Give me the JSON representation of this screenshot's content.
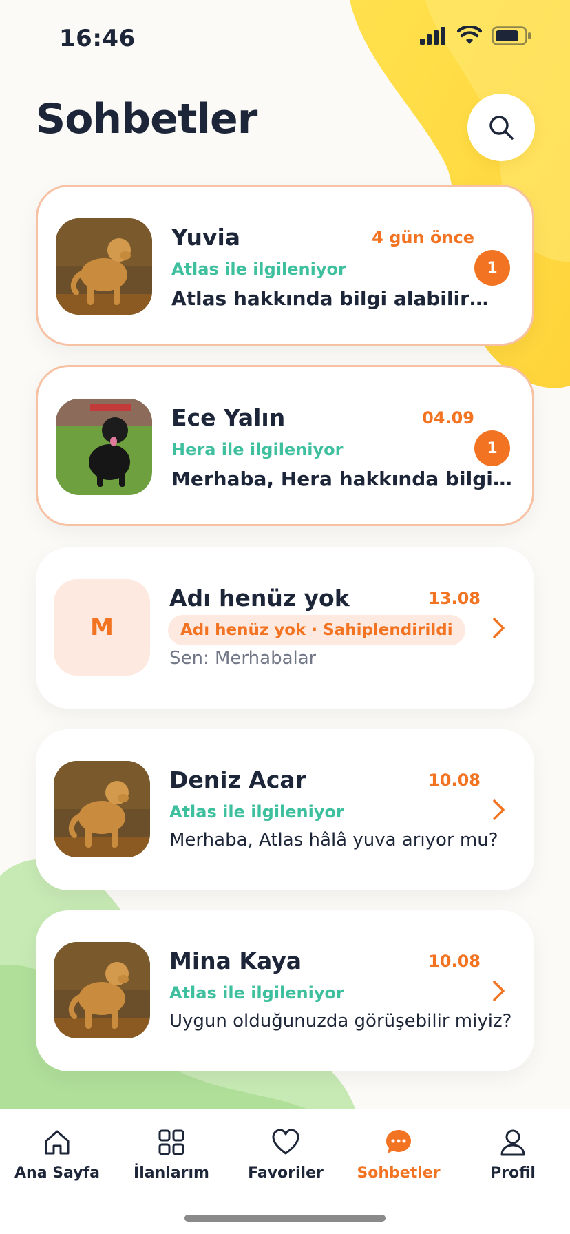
{
  "status_bar": {
    "time": "16:46",
    "icons": [
      "cellular-signal-icon",
      "wifi-icon",
      "battery-icon"
    ]
  },
  "header": {
    "title": "Sohbetler",
    "search_icon": "search-icon"
  },
  "colors": {
    "accent": "#f27321",
    "interest": "#3ebf9e",
    "unread_border": "#f7c1a3",
    "chip_bg": "#fde9df",
    "text_dark": "#1d2538",
    "muted": "#717786"
  },
  "chats": [
    {
      "name": "Yuvia",
      "time": "4 gün önce",
      "interest": "Atlas ile ilgileniyor",
      "preview": "Atlas hakkında bilgi alabilir miyim?",
      "unread_count": "1",
      "avatar": "golden-retriever"
    },
    {
      "name": "Ece Yalın",
      "time": "04.09",
      "interest": "Hera ile ilgileniyor",
      "preview": "Merhaba, Hera hakkında bilgi almak istiyorum",
      "unread_count": "1",
      "avatar": "black-labrador"
    },
    {
      "name": "Adı henüz yok",
      "time": "13.08",
      "status_chip": "Adı henüz yok · Sahiplendirildi",
      "preview": "Sen: Merhabalar",
      "avatar_letter": "M"
    },
    {
      "name": "Deniz Acar",
      "time": "10.08",
      "interest": "Atlas ile ilgileniyor",
      "preview": "Merhaba, Atlas hâlâ yuva arıyor mu?",
      "avatar": "golden-retriever"
    },
    {
      "name": "Mina Kaya",
      "time": "10.08",
      "interest": "Atlas ile ilgileniyor",
      "preview": "Uygun olduğunuzda görüşebilir miyiz?",
      "avatar": "golden-retriever"
    }
  ],
  "tab_bar": {
    "items": [
      {
        "label": "Ana Sayfa",
        "icon": "home-icon"
      },
      {
        "label": "İlanlarım",
        "icon": "grid-icon"
      },
      {
        "label": "Favoriler",
        "icon": "heart-icon"
      },
      {
        "label": "Sohbetler",
        "icon": "chat-bubble-icon",
        "active": true
      },
      {
        "label": "Profil",
        "icon": "user-icon"
      }
    ]
  }
}
